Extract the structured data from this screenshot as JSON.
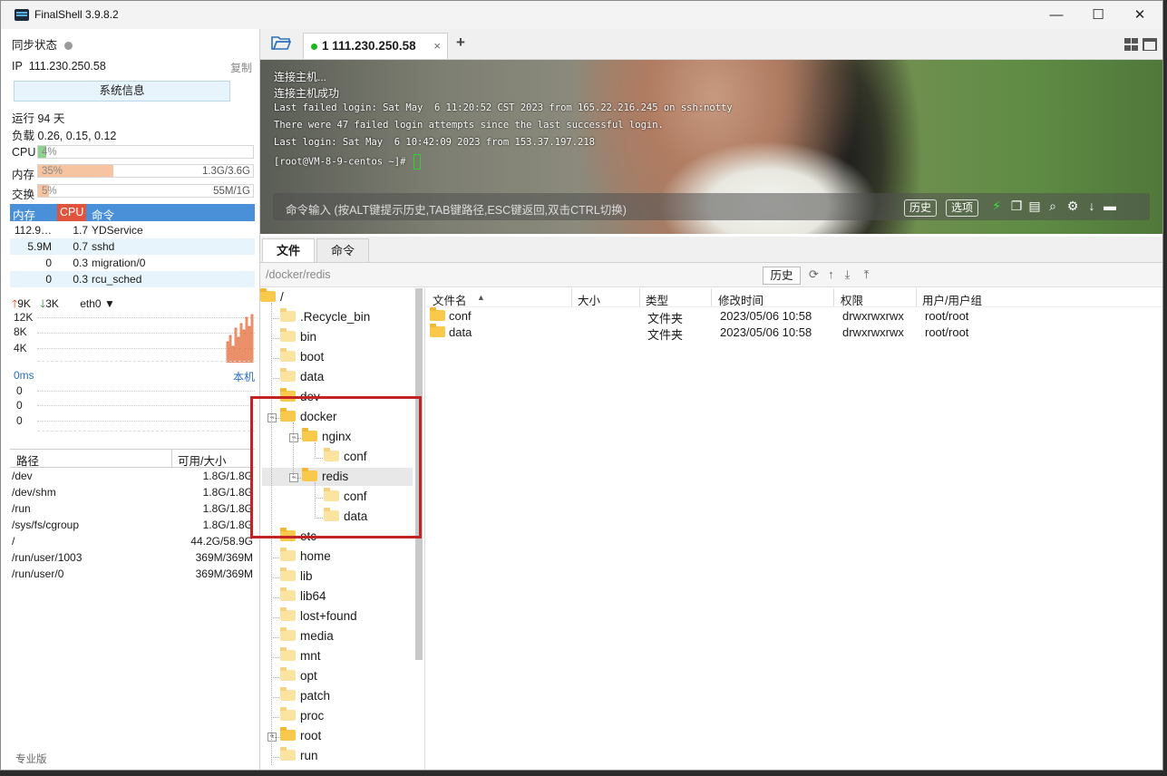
{
  "titlebar": {
    "title": "FinalShell 3.9.8.2",
    "minimize": "—",
    "maximize": "☐",
    "close": "✕"
  },
  "left": {
    "sync_label": "同步状态",
    "ip_label": "IP",
    "ip_value": "111.230.250.58",
    "copy": "复制",
    "sysinfo_button": "系统信息",
    "uptime": "运行 94 天",
    "load": "负载 0.26, 0.15, 0.12",
    "meters": [
      {
        "label": "CPU",
        "percent_text": "4%",
        "percent": 4,
        "right": "",
        "color": "#8fd18f"
      },
      {
        "label": "内存",
        "percent_text": "35%",
        "percent": 35,
        "right": "1.3G/3.6G",
        "color": "#f6c4a0"
      },
      {
        "label": "交换",
        "percent_text": "5%",
        "percent": 5,
        "right": "55M/1G",
        "color": "#f6c4a0"
      }
    ],
    "proc_headers": [
      "内存",
      "CPU",
      "命令"
    ],
    "processes": [
      {
        "mem": "112.9…",
        "cpu": "1.7",
        "cmd": "YDService"
      },
      {
        "mem": "5.9M",
        "cpu": "0.7",
        "cmd": "sshd"
      },
      {
        "mem": "0",
        "cpu": "0.3",
        "cmd": "migration/0"
      },
      {
        "mem": "0",
        "cpu": "0.3",
        "cmd": "rcu_sched"
      }
    ],
    "net": {
      "up": "9K",
      "down": "3K",
      "iface": "eth0"
    },
    "net_ticks": [
      "12K",
      "8K",
      "4K"
    ],
    "ping": {
      "label": "0ms",
      "host": "本机",
      "ticks": [
        "0",
        "0",
        "0"
      ]
    },
    "disk_headers": [
      "路径",
      "可用/大小"
    ],
    "disks": [
      {
        "path": "/dev",
        "size": "1.8G/1.8G"
      },
      {
        "path": "/dev/shm",
        "size": "1.8G/1.8G"
      },
      {
        "path": "/run",
        "size": "1.8G/1.8G"
      },
      {
        "path": "/sys/fs/cgroup",
        "size": "1.8G/1.8G"
      },
      {
        "path": "/",
        "size": "44.2G/58.9G"
      },
      {
        "path": "/run/user/1003",
        "size": "369M/369M"
      },
      {
        "path": "/run/user/0",
        "size": "369M/369M"
      }
    ],
    "edition": "专业版"
  },
  "session_tab": {
    "label": "1 111.230.250.58",
    "close": "×",
    "add": "+"
  },
  "terminal": {
    "lines": [
      "连接主机...",
      "连接主机成功",
      "Last failed login: Sat May  6 11:20:52 CST 2023 from 165.22.216.245 on ssh:notty",
      "There were 47 failed login attempts since the last successful login.",
      "Last login: Sat May  6 10:42:09 2023 from 153.37.197.218",
      "[root@VM-8-9-centos ~]# "
    ],
    "command_placeholder": "命令输入 (按ALT键提示历史,TAB键路径,ESC键返回,双击CTRL切换)",
    "history_button": "历史",
    "options_button": "选项"
  },
  "files": {
    "tabs": [
      "文件",
      "命令"
    ],
    "path": "/docker/redis",
    "history_button": "历史",
    "tree": [
      {
        "name": "/",
        "level": 0
      },
      {
        "name": ".Recycle_bin",
        "level": 1
      },
      {
        "name": "bin",
        "level": 1
      },
      {
        "name": "boot",
        "level": 1
      },
      {
        "name": "data",
        "level": 1
      },
      {
        "name": "dev",
        "level": 1
      },
      {
        "name": "docker",
        "level": 1
      },
      {
        "name": "nginx",
        "level": 2
      },
      {
        "name": "conf",
        "level": 3
      },
      {
        "name": "redis",
        "level": 2
      },
      {
        "name": "conf",
        "level": 3
      },
      {
        "name": "data",
        "level": 3
      },
      {
        "name": "etc",
        "level": 1
      },
      {
        "name": "home",
        "level": 1
      },
      {
        "name": "lib",
        "level": 1
      },
      {
        "name": "lib64",
        "level": 1
      },
      {
        "name": "lost+found",
        "level": 1
      },
      {
        "name": "media",
        "level": 1
      },
      {
        "name": "mnt",
        "level": 1
      },
      {
        "name": "opt",
        "level": 1
      },
      {
        "name": "patch",
        "level": 1
      },
      {
        "name": "proc",
        "level": 1
      },
      {
        "name": "root",
        "level": 1
      },
      {
        "name": "run",
        "level": 1
      }
    ],
    "columns": [
      "文件名",
      "大小",
      "类型",
      "修改时间",
      "权限",
      "用户/用户组"
    ],
    "rows": [
      {
        "name": "conf",
        "size": "",
        "type": "文件夹",
        "mtime": "2023/05/06 10:58",
        "perm": "drwxrwxrwx",
        "owner": "root/root"
      },
      {
        "name": "data",
        "size": "",
        "type": "文件夹",
        "mtime": "2023/05/06 10:58",
        "perm": "drwxrwxrwx",
        "owner": "root/root"
      }
    ]
  }
}
